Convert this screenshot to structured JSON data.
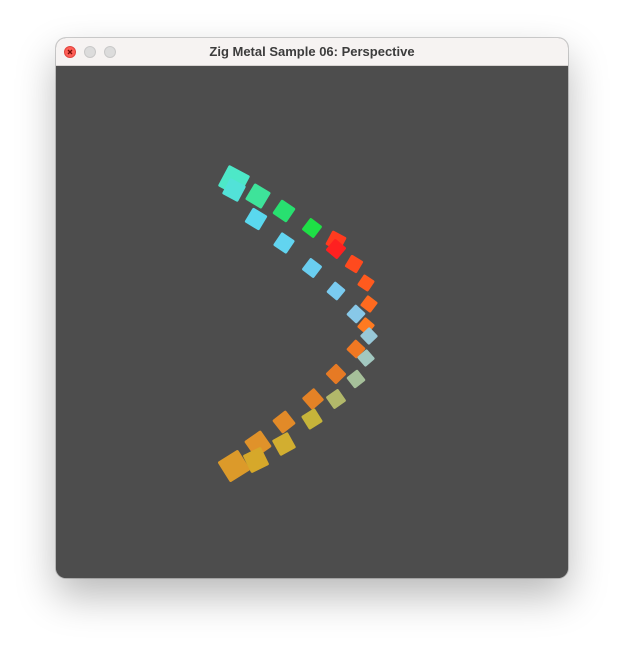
{
  "window": {
    "title": "Zig Metal Sample 06: Perspective",
    "background_color": "#4d4d4d"
  },
  "traffic_lights": [
    {
      "name": "close",
      "icon": "close-icon",
      "color": "#fe5f57"
    },
    {
      "name": "minimize",
      "icon": "minimize-icon",
      "color": "#dcdcdc"
    },
    {
      "name": "maximize",
      "icon": "maximize-icon",
      "color": "#dcdcdc"
    }
  ],
  "scene": {
    "arcs": [
      {
        "name": "top-arc",
        "cubes": [
          {
            "color": "#ff3b1f"
          },
          {
            "color": "#ff4a1e"
          },
          {
            "color": "#ff5a1e"
          },
          {
            "color": "#ff6a1f"
          },
          {
            "color": "#ff7a20"
          },
          {
            "color": "#f07822"
          },
          {
            "color": "#e67a24"
          },
          {
            "color": "#e48226"
          },
          {
            "color": "#e28a28"
          },
          {
            "color": "#e0922a"
          },
          {
            "color": "#dc9a2a"
          }
        ]
      },
      {
        "name": "outer-arc",
        "cubes": [
          {
            "color": "#4de8c8"
          },
          {
            "color": "#3ee39a"
          },
          {
            "color": "#28e070"
          },
          {
            "color": "#1ee046"
          },
          {
            "color": "#ff2020"
          }
        ]
      },
      {
        "name": "inner-arc",
        "cubes": [
          {
            "color": "#52e2d8"
          },
          {
            "color": "#5ad8ee"
          },
          {
            "color": "#62d4f0"
          },
          {
            "color": "#6acef0"
          },
          {
            "color": "#7acbf0"
          },
          {
            "color": "#88c8e8"
          },
          {
            "color": "#98c8d8"
          },
          {
            "color": "#a2c8c0"
          },
          {
            "color": "#a6c09a"
          },
          {
            "color": "#b2b86a"
          },
          {
            "color": "#c6b43a"
          },
          {
            "color": "#d2ae30"
          },
          {
            "color": "#d6a82a"
          }
        ]
      }
    ]
  }
}
